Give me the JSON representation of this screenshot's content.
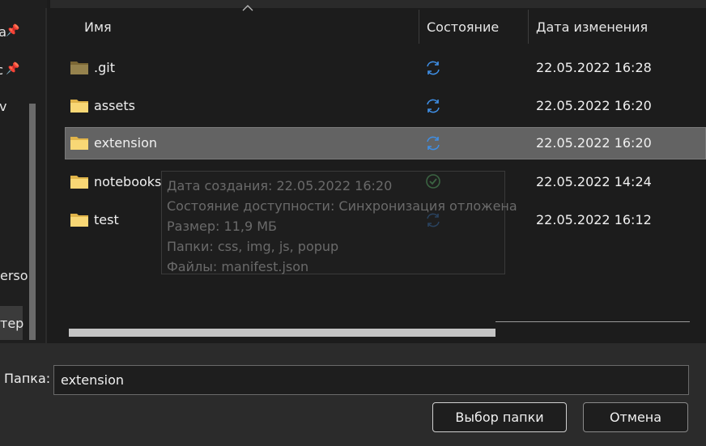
{
  "nav": {
    "items": [
      {
        "label": "а",
        "pinned": true
      },
      {
        "label": "с",
        "pinned": true
      },
      {
        "label": "v",
        "pinned": false
      },
      {
        "label": "erso",
        "pinned": false
      },
      {
        "label": "тер",
        "pinned": false
      }
    ]
  },
  "columns": {
    "name": "Имя",
    "status": "Состояние",
    "date": "Дата изменения"
  },
  "files": [
    {
      "name": ".git",
      "status_icon": "sync-pending-icon",
      "date": "22.05.2022 16:28",
      "selected": false,
      "hidden": true
    },
    {
      "name": "assets",
      "status_icon": "sync-pending-icon",
      "date": "22.05.2022 16:20",
      "selected": false,
      "hidden": false
    },
    {
      "name": "extension",
      "status_icon": "sync-pending-icon",
      "date": "22.05.2022 16:20",
      "selected": true,
      "hidden": false
    },
    {
      "name": "notebooks",
      "status_icon": "synced-check-icon",
      "date": "22.05.2022 14:24",
      "selected": false,
      "hidden": false
    },
    {
      "name": "test",
      "status_icon": "sync-pending-icon",
      "date": "22.05.2022 16:12",
      "selected": false,
      "hidden": false
    }
  ],
  "tooltip": {
    "lines": [
      "Дата создания: 22.05.2022 16:20",
      "Состояние доступности: Синхронизация отложена",
      "Размер: 11,9 МБ",
      "Папки: css, img, js, popup",
      "Файлы: manifest.json"
    ]
  },
  "footer": {
    "folder_label": "Папка:",
    "folder_value": "extension",
    "select_button": "Выбор папки",
    "cancel_button": "Отмена"
  },
  "colors": {
    "background": "#1c1c1c",
    "selected_row": "#636363",
    "folder_yellow": "#f8d775",
    "sync_blue": "#3f8fe6",
    "check_green": "#5bb56a"
  }
}
